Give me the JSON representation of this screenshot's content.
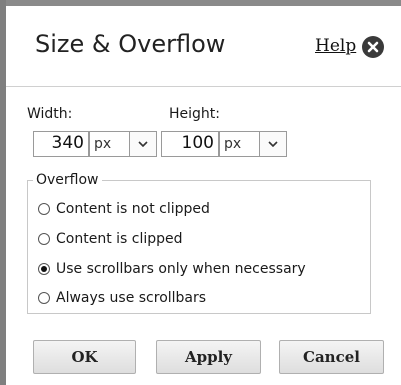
{
  "dialog": {
    "title": "Size & Overflow",
    "help_label": "Help",
    "close_icon": "close-icon"
  },
  "size": {
    "width_label": "Width:",
    "width_value": "340",
    "width_unit": "px",
    "height_label": "Height:",
    "height_value": "100",
    "height_unit": "px"
  },
  "overflow": {
    "legend": "Overflow",
    "options": [
      {
        "label": "Content is not clipped",
        "checked": false
      },
      {
        "label": "Content is clipped",
        "checked": false
      },
      {
        "label": "Use scrollbars only when necessary",
        "checked": true
      },
      {
        "label": "Always use scrollbars",
        "checked": false
      }
    ]
  },
  "buttons": {
    "ok": "OK",
    "apply": "Apply",
    "cancel": "Cancel"
  },
  "colors": {
    "frame": "#7f7f7f",
    "close_button": "#3a3a3a",
    "button_bg": "#e6e6e6"
  }
}
